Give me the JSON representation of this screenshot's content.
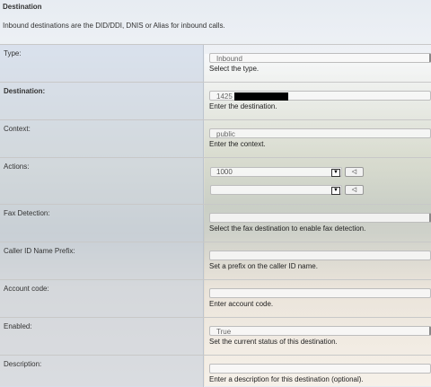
{
  "header": {
    "title": "Destination",
    "description": "Inbound destinations are the DID/DDI, DNIS or Alias for inbound calls."
  },
  "fields": {
    "type": {
      "label": "Type:",
      "value": "Inbound",
      "hint": "Select the type."
    },
    "destination": {
      "label": "Destination:",
      "value": "1425",
      "hint": "Enter the destination."
    },
    "context": {
      "label": "Context:",
      "value": "public",
      "hint": "Enter the context."
    },
    "actions": {
      "label": "Actions:",
      "value1": "1000",
      "value2": "",
      "add_glyph": "◁"
    },
    "fax_detection": {
      "label": "Fax Detection:",
      "value": "",
      "hint": "Select the fax destination to enable fax detection."
    },
    "caller_id_prefix": {
      "label": "Caller ID Name Prefix:",
      "value": "",
      "hint": "Set a prefix on the caller ID name."
    },
    "account_code": {
      "label": "Account code:",
      "value": "",
      "hint": "Enter account code."
    },
    "enabled": {
      "label": "Enabled:",
      "value": "True",
      "hint": "Set the current status of this destination."
    },
    "description": {
      "label": "Description:",
      "value": "",
      "hint": "Enter a description for this destination (optional)."
    }
  },
  "icons": {
    "dropdown": "chevron-down-icon",
    "add": "arrow-left-icon"
  }
}
